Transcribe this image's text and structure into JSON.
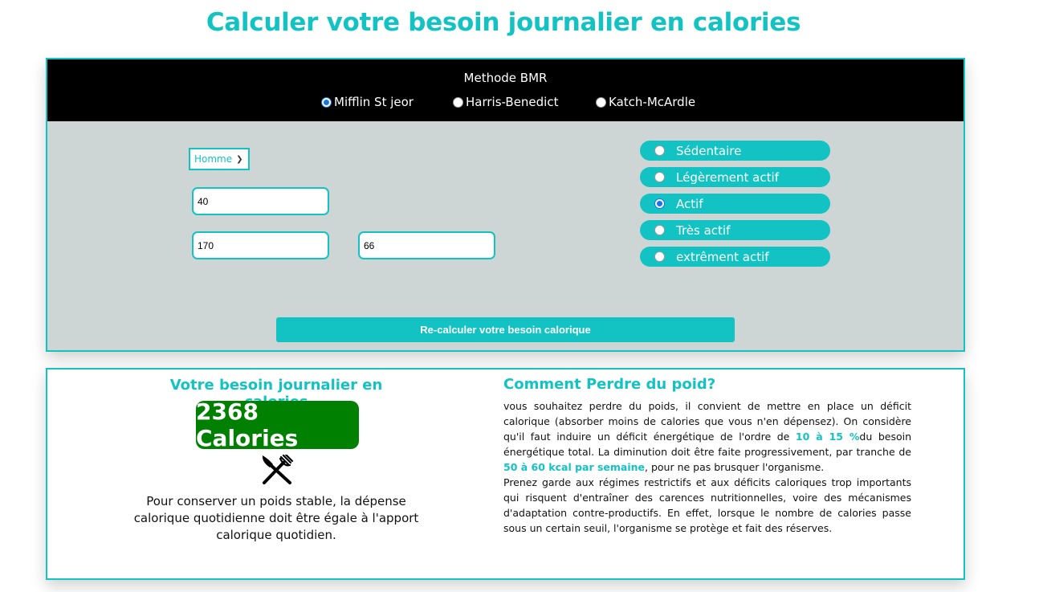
{
  "title": "Calculer votre besoin journalier en calories",
  "bmr": {
    "label": "Methode BMR",
    "options": [
      {
        "label": "Mifflin St jeor",
        "checked": true
      },
      {
        "label": "Harris-Benedict",
        "checked": false
      },
      {
        "label": "Katch-McArdle",
        "checked": false
      }
    ]
  },
  "form": {
    "sex": "Homme",
    "age": "40",
    "height": "170",
    "weight": "66"
  },
  "activity": [
    {
      "label": "Sédentaire",
      "checked": false
    },
    {
      "label": "Légèrement actif",
      "checked": false
    },
    {
      "label": "Actif",
      "checked": true
    },
    {
      "label": "Très actif",
      "checked": false
    },
    {
      "label": "extrêment actif",
      "checked": false
    }
  ],
  "recalc_label": "Re-calculer votre besoin calorique",
  "result": {
    "title": "Votre besoin journalier en calories",
    "calories": "2368 Calories",
    "stable_text": "Pour conserver un poids stable, la dépense calorique quotidienne doit être égale à l'apport calorique quotidien."
  },
  "lose": {
    "title": "Comment Perdre du poid?",
    "p1_a": "vous souhaitez perdre du poids, il convient de mettre en place un déficit calorique (absorber moins de calories que vous n'en dépensez). On considère qu'il faut induire un déficit énergétique de l'ordre de ",
    "p1_hl1": "10 à 15 %",
    "p1_b": "du besoin énergétique total. La diminution doit être faite progressivement, par tranche de ",
    "p1_hl2": "50 à 60 kcal par semaine",
    "p1_c": ", pour ne pas brusquer l'organisme.",
    "p2": "Prenez garde aux régimes restrictifs et aux déficits caloriques trop importants qui risquent d'entraîner des carences nutritionnelles, voire des mécanismes d'adaptation contre-productifs. En effet, lorsque le nombre de calories passe sous un certain seuil, l'organisme se protège et fait des réserves."
  },
  "colors": {
    "accent": "#13c3c3",
    "green": "#008000",
    "panel": "#ced5d5"
  },
  "icons": [
    "cutlery-icon",
    "chevron-down-icon"
  ]
}
